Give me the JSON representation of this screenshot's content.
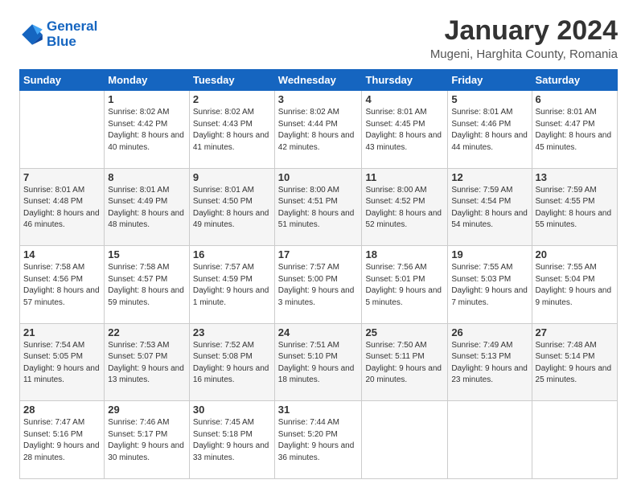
{
  "header": {
    "logo_line1": "General",
    "logo_line2": "Blue",
    "month_title": "January 2024",
    "subtitle": "Mugeni, Harghita County, Romania"
  },
  "days_of_week": [
    "Sunday",
    "Monday",
    "Tuesday",
    "Wednesday",
    "Thursday",
    "Friday",
    "Saturday"
  ],
  "weeks": [
    [
      {
        "day": "",
        "sunrise": "",
        "sunset": "",
        "daylight": ""
      },
      {
        "day": "1",
        "sunrise": "Sunrise: 8:02 AM",
        "sunset": "Sunset: 4:42 PM",
        "daylight": "Daylight: 8 hours and 40 minutes."
      },
      {
        "day": "2",
        "sunrise": "Sunrise: 8:02 AM",
        "sunset": "Sunset: 4:43 PM",
        "daylight": "Daylight: 8 hours and 41 minutes."
      },
      {
        "day": "3",
        "sunrise": "Sunrise: 8:02 AM",
        "sunset": "Sunset: 4:44 PM",
        "daylight": "Daylight: 8 hours and 42 minutes."
      },
      {
        "day": "4",
        "sunrise": "Sunrise: 8:01 AM",
        "sunset": "Sunset: 4:45 PM",
        "daylight": "Daylight: 8 hours and 43 minutes."
      },
      {
        "day": "5",
        "sunrise": "Sunrise: 8:01 AM",
        "sunset": "Sunset: 4:46 PM",
        "daylight": "Daylight: 8 hours and 44 minutes."
      },
      {
        "day": "6",
        "sunrise": "Sunrise: 8:01 AM",
        "sunset": "Sunset: 4:47 PM",
        "daylight": "Daylight: 8 hours and 45 minutes."
      }
    ],
    [
      {
        "day": "7",
        "sunrise": "Sunrise: 8:01 AM",
        "sunset": "Sunset: 4:48 PM",
        "daylight": "Daylight: 8 hours and 46 minutes."
      },
      {
        "day": "8",
        "sunrise": "Sunrise: 8:01 AM",
        "sunset": "Sunset: 4:49 PM",
        "daylight": "Daylight: 8 hours and 48 minutes."
      },
      {
        "day": "9",
        "sunrise": "Sunrise: 8:01 AM",
        "sunset": "Sunset: 4:50 PM",
        "daylight": "Daylight: 8 hours and 49 minutes."
      },
      {
        "day": "10",
        "sunrise": "Sunrise: 8:00 AM",
        "sunset": "Sunset: 4:51 PM",
        "daylight": "Daylight: 8 hours and 51 minutes."
      },
      {
        "day": "11",
        "sunrise": "Sunrise: 8:00 AM",
        "sunset": "Sunset: 4:52 PM",
        "daylight": "Daylight: 8 hours and 52 minutes."
      },
      {
        "day": "12",
        "sunrise": "Sunrise: 7:59 AM",
        "sunset": "Sunset: 4:54 PM",
        "daylight": "Daylight: 8 hours and 54 minutes."
      },
      {
        "day": "13",
        "sunrise": "Sunrise: 7:59 AM",
        "sunset": "Sunset: 4:55 PM",
        "daylight": "Daylight: 8 hours and 55 minutes."
      }
    ],
    [
      {
        "day": "14",
        "sunrise": "Sunrise: 7:58 AM",
        "sunset": "Sunset: 4:56 PM",
        "daylight": "Daylight: 8 hours and 57 minutes."
      },
      {
        "day": "15",
        "sunrise": "Sunrise: 7:58 AM",
        "sunset": "Sunset: 4:57 PM",
        "daylight": "Daylight: 8 hours and 59 minutes."
      },
      {
        "day": "16",
        "sunrise": "Sunrise: 7:57 AM",
        "sunset": "Sunset: 4:59 PM",
        "daylight": "Daylight: 9 hours and 1 minute."
      },
      {
        "day": "17",
        "sunrise": "Sunrise: 7:57 AM",
        "sunset": "Sunset: 5:00 PM",
        "daylight": "Daylight: 9 hours and 3 minutes."
      },
      {
        "day": "18",
        "sunrise": "Sunrise: 7:56 AM",
        "sunset": "Sunset: 5:01 PM",
        "daylight": "Daylight: 9 hours and 5 minutes."
      },
      {
        "day": "19",
        "sunrise": "Sunrise: 7:55 AM",
        "sunset": "Sunset: 5:03 PM",
        "daylight": "Daylight: 9 hours and 7 minutes."
      },
      {
        "day": "20",
        "sunrise": "Sunrise: 7:55 AM",
        "sunset": "Sunset: 5:04 PM",
        "daylight": "Daylight: 9 hours and 9 minutes."
      }
    ],
    [
      {
        "day": "21",
        "sunrise": "Sunrise: 7:54 AM",
        "sunset": "Sunset: 5:05 PM",
        "daylight": "Daylight: 9 hours and 11 minutes."
      },
      {
        "day": "22",
        "sunrise": "Sunrise: 7:53 AM",
        "sunset": "Sunset: 5:07 PM",
        "daylight": "Daylight: 9 hours and 13 minutes."
      },
      {
        "day": "23",
        "sunrise": "Sunrise: 7:52 AM",
        "sunset": "Sunset: 5:08 PM",
        "daylight": "Daylight: 9 hours and 16 minutes."
      },
      {
        "day": "24",
        "sunrise": "Sunrise: 7:51 AM",
        "sunset": "Sunset: 5:10 PM",
        "daylight": "Daylight: 9 hours and 18 minutes."
      },
      {
        "day": "25",
        "sunrise": "Sunrise: 7:50 AM",
        "sunset": "Sunset: 5:11 PM",
        "daylight": "Daylight: 9 hours and 20 minutes."
      },
      {
        "day": "26",
        "sunrise": "Sunrise: 7:49 AM",
        "sunset": "Sunset: 5:13 PM",
        "daylight": "Daylight: 9 hours and 23 minutes."
      },
      {
        "day": "27",
        "sunrise": "Sunrise: 7:48 AM",
        "sunset": "Sunset: 5:14 PM",
        "daylight": "Daylight: 9 hours and 25 minutes."
      }
    ],
    [
      {
        "day": "28",
        "sunrise": "Sunrise: 7:47 AM",
        "sunset": "Sunset: 5:16 PM",
        "daylight": "Daylight: 9 hours and 28 minutes."
      },
      {
        "day": "29",
        "sunrise": "Sunrise: 7:46 AM",
        "sunset": "Sunset: 5:17 PM",
        "daylight": "Daylight: 9 hours and 30 minutes."
      },
      {
        "day": "30",
        "sunrise": "Sunrise: 7:45 AM",
        "sunset": "Sunset: 5:18 PM",
        "daylight": "Daylight: 9 hours and 33 minutes."
      },
      {
        "day": "31",
        "sunrise": "Sunrise: 7:44 AM",
        "sunset": "Sunset: 5:20 PM",
        "daylight": "Daylight: 9 hours and 36 minutes."
      },
      {
        "day": "",
        "sunrise": "",
        "sunset": "",
        "daylight": ""
      },
      {
        "day": "",
        "sunrise": "",
        "sunset": "",
        "daylight": ""
      },
      {
        "day": "",
        "sunrise": "",
        "sunset": "",
        "daylight": ""
      }
    ]
  ]
}
